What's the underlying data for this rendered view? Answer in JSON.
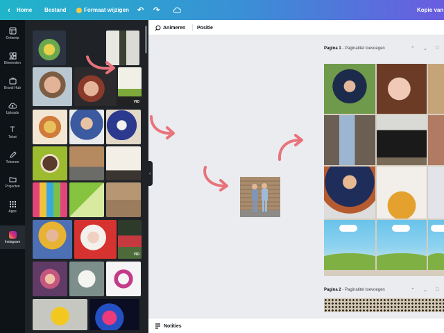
{
  "topbar": {
    "home_label": "Home",
    "file_label": "Bestand",
    "resize_label": "Formaat wijzigen",
    "title": "Kopie van C"
  },
  "rail": {
    "items": [
      {
        "label": "Ontwerp",
        "icon": "layout-icon"
      },
      {
        "label": "Elementen",
        "icon": "shapes-icon"
      },
      {
        "label": "Brand Hub",
        "icon": "briefcase-icon"
      },
      {
        "label": "Uploads",
        "icon": "cloud-upload-icon"
      },
      {
        "label": "Tekst",
        "icon": "text-icon"
      },
      {
        "label": "Tekenen",
        "icon": "pen-icon"
      },
      {
        "label": "Projecten",
        "icon": "folder-icon"
      },
      {
        "label": "Apps",
        "icon": "grid-icon"
      },
      {
        "label": "Instagram",
        "icon": "instagram-icon"
      }
    ]
  },
  "panel": {
    "video_badge": "VID"
  },
  "canvas_toolbar": {
    "animate_label": "Animeren",
    "position_label": "Positie"
  },
  "pages": [
    {
      "label": "Pagina 1",
      "title_placeholder": "Paginatitel toevoegen"
    },
    {
      "label": "Pagina 2",
      "title_placeholder": "Paginatitel toevoegen"
    }
  ],
  "bottombar": {
    "notes_label": "Notities"
  },
  "colors": {
    "topbar_start": "#1fb5c9",
    "topbar_end": "#6a5ce0",
    "arrow": "#e8737b",
    "panel_bg": "#1f2328"
  }
}
